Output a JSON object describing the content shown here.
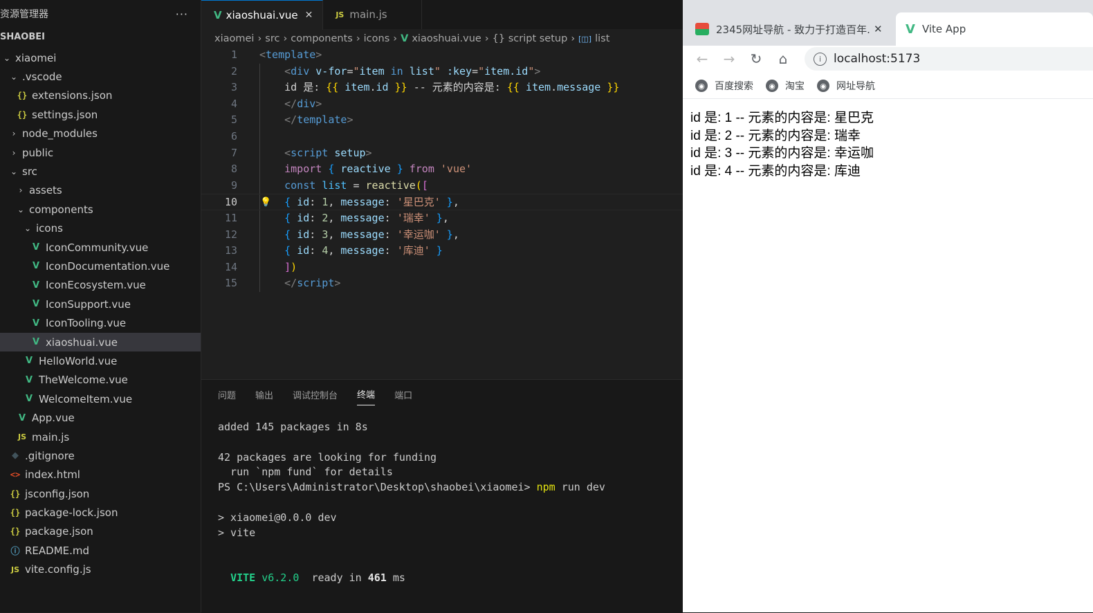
{
  "sidebar": {
    "title": "资源管理器",
    "more": "···",
    "project": "SHAOBEI",
    "tree": [
      {
        "label": "xiaomei",
        "chev": "⌄",
        "icon": "",
        "depth": 0
      },
      {
        "label": ".vscode",
        "chev": "⌄",
        "icon": "",
        "depth": 1
      },
      {
        "label": "extensions.json",
        "chev": "",
        "icon": "json",
        "depth": 2
      },
      {
        "label": "settings.json",
        "chev": "",
        "icon": "json",
        "depth": 2
      },
      {
        "label": "node_modules",
        "chev": "›",
        "icon": "",
        "depth": 1
      },
      {
        "label": "public",
        "chev": "›",
        "icon": "",
        "depth": 1
      },
      {
        "label": "src",
        "chev": "⌄",
        "icon": "",
        "depth": 1
      },
      {
        "label": "assets",
        "chev": "›",
        "icon": "",
        "depth": 2
      },
      {
        "label": "components",
        "chev": "⌄",
        "icon": "",
        "depth": 2
      },
      {
        "label": "icons",
        "chev": "⌄",
        "icon": "",
        "depth": 3
      },
      {
        "label": "IconCommunity.vue",
        "chev": "",
        "icon": "vue",
        "depth": 4
      },
      {
        "label": "IconDocumentation.vue",
        "chev": "",
        "icon": "vue",
        "depth": 4
      },
      {
        "label": "IconEcosystem.vue",
        "chev": "",
        "icon": "vue",
        "depth": 4
      },
      {
        "label": "IconSupport.vue",
        "chev": "",
        "icon": "vue",
        "depth": 4
      },
      {
        "label": "IconTooling.vue",
        "chev": "",
        "icon": "vue",
        "depth": 4
      },
      {
        "label": "xiaoshuai.vue",
        "chev": "",
        "icon": "vue",
        "depth": 4,
        "selected": true
      },
      {
        "label": "HelloWorld.vue",
        "chev": "",
        "icon": "vue",
        "depth": 3
      },
      {
        "label": "TheWelcome.vue",
        "chev": "",
        "icon": "vue",
        "depth": 3
      },
      {
        "label": "WelcomeItem.vue",
        "chev": "",
        "icon": "vue",
        "depth": 3
      },
      {
        "label": "App.vue",
        "chev": "",
        "icon": "vue",
        "depth": 2
      },
      {
        "label": "main.js",
        "chev": "",
        "icon": "js",
        "depth": 2
      },
      {
        "label": ".gitignore",
        "chev": "",
        "icon": "git",
        "depth": 1
      },
      {
        "label": "index.html",
        "chev": "",
        "icon": "html",
        "depth": 1
      },
      {
        "label": "jsconfig.json",
        "chev": "",
        "icon": "json",
        "depth": 1
      },
      {
        "label": "package-lock.json",
        "chev": "",
        "icon": "json",
        "depth": 1
      },
      {
        "label": "package.json",
        "chev": "",
        "icon": "json",
        "depth": 1
      },
      {
        "label": "README.md",
        "chev": "",
        "icon": "info",
        "depth": 1
      },
      {
        "label": "vite.config.js",
        "chev": "",
        "icon": "js",
        "depth": 1
      }
    ]
  },
  "editor": {
    "tabs": [
      {
        "label": "xiaoshuai.vue",
        "icon": "vue",
        "active": true,
        "close": "✕"
      },
      {
        "label": "main.js",
        "icon": "js",
        "active": false
      }
    ],
    "breadcrumb": [
      "xiaomei",
      "src",
      "components",
      "icons",
      "xiaoshuai.vue",
      "{} script setup",
      "list"
    ],
    "current_line": 10,
    "lines": [
      [
        [
          "t-tag",
          "<"
        ],
        [
          "t-el",
          "template"
        ],
        [
          "t-tag",
          ">"
        ]
      ],
      [
        [
          "t-plain",
          "    "
        ],
        [
          "t-tag",
          "<"
        ],
        [
          "t-el",
          "div"
        ],
        [
          "t-plain",
          " "
        ],
        [
          "t-attr",
          "v-for"
        ],
        [
          "t-plain",
          "="
        ],
        [
          "t-str",
          "\""
        ],
        [
          "t-attr",
          "item"
        ],
        [
          "t-plain",
          " "
        ],
        [
          "t-kw",
          "in"
        ],
        [
          "t-plain",
          " "
        ],
        [
          "t-attr",
          "list"
        ],
        [
          "t-str",
          "\""
        ],
        [
          "t-plain",
          " "
        ],
        [
          "t-attr",
          ":key"
        ],
        [
          "t-plain",
          "="
        ],
        [
          "t-str",
          "\""
        ],
        [
          "t-attr",
          "item.id"
        ],
        [
          "t-str",
          "\""
        ],
        [
          "t-tag",
          ">"
        ]
      ],
      [
        [
          "t-plain",
          "    id 是: "
        ],
        [
          "t-brace",
          "{{"
        ],
        [
          "t-plain",
          " "
        ],
        [
          "t-attr",
          "item"
        ],
        [
          "t-plain",
          "."
        ],
        [
          "t-attr",
          "id"
        ],
        [
          "t-plain",
          " "
        ],
        [
          "t-brace",
          "}}"
        ],
        [
          "t-plain",
          " -- 元素的内容是: "
        ],
        [
          "t-brace",
          "{{"
        ],
        [
          "t-plain",
          " "
        ],
        [
          "t-attr",
          "item"
        ],
        [
          "t-plain",
          "."
        ],
        [
          "t-attr",
          "message"
        ],
        [
          "t-plain",
          " "
        ],
        [
          "t-brace",
          "}}"
        ]
      ],
      [
        [
          "t-plain",
          "    "
        ],
        [
          "t-tag",
          "</"
        ],
        [
          "t-el",
          "div"
        ],
        [
          "t-tag",
          ">"
        ]
      ],
      [
        [
          "t-plain",
          "    "
        ],
        [
          "t-tag",
          "</"
        ],
        [
          "t-el",
          "template"
        ],
        [
          "t-tag",
          ">"
        ]
      ],
      [],
      [
        [
          "t-plain",
          "    "
        ],
        [
          "t-tag",
          "<"
        ],
        [
          "t-el",
          "script"
        ],
        [
          "t-plain",
          " "
        ],
        [
          "t-attr",
          "setup"
        ],
        [
          "t-tag",
          ">"
        ]
      ],
      [
        [
          "t-plain",
          "    "
        ],
        [
          "t-kw2",
          "import"
        ],
        [
          "t-plain",
          " "
        ],
        [
          "t-br3",
          "{"
        ],
        [
          "t-plain",
          " "
        ],
        [
          "t-prop",
          "reactive"
        ],
        [
          "t-plain",
          " "
        ],
        [
          "t-br3",
          "}"
        ],
        [
          "t-plain",
          " "
        ],
        [
          "t-kw2",
          "from"
        ],
        [
          "t-plain",
          " "
        ],
        [
          "t-str",
          "'vue'"
        ]
      ],
      [
        [
          "t-plain",
          "    "
        ],
        [
          "t-kw",
          "const"
        ],
        [
          "t-plain",
          " "
        ],
        [
          "t-var",
          "list"
        ],
        [
          "t-plain",
          " = "
        ],
        [
          "t-fn",
          "reactive"
        ],
        [
          "t-brace",
          "("
        ],
        [
          "t-br2",
          "["
        ]
      ],
      [
        [
          "t-plain",
          "    "
        ],
        [
          "t-br3",
          "{"
        ],
        [
          "t-plain",
          " "
        ],
        [
          "t-prop",
          "id"
        ],
        [
          "t-plain",
          ": "
        ],
        [
          "t-num",
          "1"
        ],
        [
          "t-plain",
          ", "
        ],
        [
          "t-prop",
          "message"
        ],
        [
          "t-plain",
          ": "
        ],
        [
          "t-str",
          "'星巴克'"
        ],
        [
          "t-plain",
          " "
        ],
        [
          "t-br3",
          "}"
        ],
        [
          "t-plain",
          ","
        ]
      ],
      [
        [
          "t-plain",
          "    "
        ],
        [
          "t-br3",
          "{"
        ],
        [
          "t-plain",
          " "
        ],
        [
          "t-prop",
          "id"
        ],
        [
          "t-plain",
          ": "
        ],
        [
          "t-num",
          "2"
        ],
        [
          "t-plain",
          ", "
        ],
        [
          "t-prop",
          "message"
        ],
        [
          "t-plain",
          ": "
        ],
        [
          "t-str",
          "'瑞幸'"
        ],
        [
          "t-plain",
          " "
        ],
        [
          "t-br3",
          "}"
        ],
        [
          "t-plain",
          ","
        ]
      ],
      [
        [
          "t-plain",
          "    "
        ],
        [
          "t-br3",
          "{"
        ],
        [
          "t-plain",
          " "
        ],
        [
          "t-prop",
          "id"
        ],
        [
          "t-plain",
          ": "
        ],
        [
          "t-num",
          "3"
        ],
        [
          "t-plain",
          ", "
        ],
        [
          "t-prop",
          "message"
        ],
        [
          "t-plain",
          ": "
        ],
        [
          "t-str",
          "'幸运咖'"
        ],
        [
          "t-plain",
          " "
        ],
        [
          "t-br3",
          "}"
        ],
        [
          "t-plain",
          ","
        ]
      ],
      [
        [
          "t-plain",
          "    "
        ],
        [
          "t-br3",
          "{"
        ],
        [
          "t-plain",
          " "
        ],
        [
          "t-prop",
          "id"
        ],
        [
          "t-plain",
          ": "
        ],
        [
          "t-num",
          "4"
        ],
        [
          "t-plain",
          ", "
        ],
        [
          "t-prop",
          "message"
        ],
        [
          "t-plain",
          ": "
        ],
        [
          "t-str",
          "'库迪'"
        ],
        [
          "t-plain",
          " "
        ],
        [
          "t-br3",
          "}"
        ]
      ],
      [
        [
          "t-plain",
          "    "
        ],
        [
          "t-br2",
          "]"
        ],
        [
          "t-brace",
          ")"
        ]
      ],
      [
        [
          "t-plain",
          "    "
        ],
        [
          "t-tag",
          "</"
        ],
        [
          "t-el",
          "script"
        ],
        [
          "t-tag",
          ">"
        ]
      ]
    ]
  },
  "panel": {
    "tabs": [
      "问题",
      "输出",
      "调试控制台",
      "终端",
      "端口"
    ],
    "active_tab": "终端",
    "terminal": {
      "l1": "added 145 packages in 8s",
      "l2": "42 packages are looking for funding",
      "l3": "  run `npm fund` for details",
      "l4_prompt": "PS C:\\Users\\Administrator\\Desktop\\shaobei\\xiaomei> ",
      "l4_cmd": "npm",
      "l4_args": " run dev",
      "l5": "> xiaomei@0.0.0 dev",
      "l6": "> vite",
      "vite_name": "VITE",
      "vite_ver": "v6.2.0",
      "ready_pre": "  ready in ",
      "ready_ms": "461",
      "ready_post": " ms"
    }
  },
  "browser": {
    "tab1": "2345网址导航 - 致力于打造百年...",
    "tab1_close": "✕",
    "tab2": "Vite App",
    "url": "localhost:5173",
    "bookmarks": [
      "百度搜索",
      "淘宝",
      "网址导航"
    ],
    "items": [
      "id 是: 1 -- 元素的内容是: 星巴克",
      "id 是: 2 -- 元素的内容是: 瑞幸",
      "id 是: 3 -- 元素的内容是: 幸运咖",
      "id 是: 4 -- 元素的内容是: 库迪"
    ]
  }
}
